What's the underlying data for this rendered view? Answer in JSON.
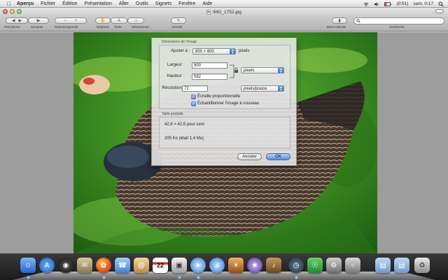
{
  "menubar": {
    "app": "Aperçu",
    "items": [
      "Fichier",
      "Édition",
      "Présentation",
      "Aller",
      "Outils",
      "Signets",
      "Fenêtre",
      "Aide"
    ],
    "battery": "(0:51)",
    "clock": "sam. 0:17"
  },
  "window": {
    "title": "IMG_1752.jpg"
  },
  "toolbar": {
    "prev_next": "Précédente",
    "sidebar_right": "Suivante",
    "zoom": "Réduire/agrandir",
    "move": "Déplacer",
    "text": "Texte",
    "select": "Sélectionner",
    "annotate": "Annoter",
    "sidebar": "Barre latérale",
    "search": "Recherche"
  },
  "dialog": {
    "section_dims": "Dimensions de l'image",
    "fit_label": "Ajuster à :",
    "fit_value": "800 × 600",
    "fit_unit": "pixels",
    "width_label": "Largeur :",
    "width_value": "800",
    "height_label": "Hauteur :",
    "height_value": "582",
    "unit_value": "pixels",
    "resolution_label": "Résolution :",
    "resolution_value": "72",
    "resolution_unit": "pixels/pouce",
    "check_scale": "Échelle proportionnelle",
    "check_resample": "Échantillonner l'image à nouveau",
    "section_size": "Taille produite",
    "percent": "42,6 × 42,5 pour cent",
    "filesize": "205 Ko (était 1,4 Mo)",
    "cancel": "Annuler",
    "ok": "OK"
  },
  "colors": {
    "accent": "#3b7bd8",
    "dock": "#1b1b1b"
  }
}
